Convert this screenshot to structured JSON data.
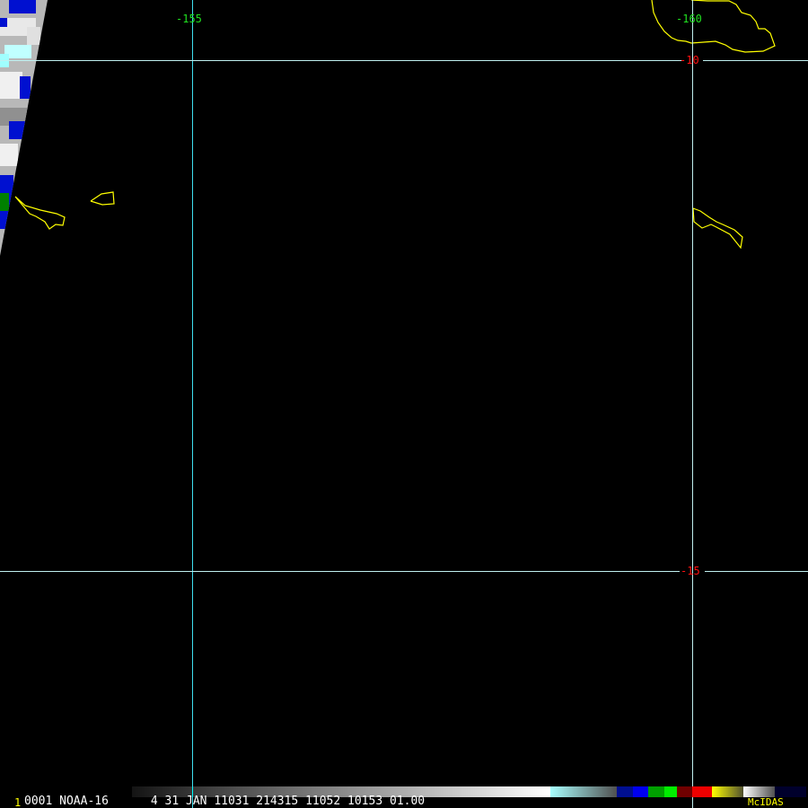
{
  "map": {
    "longitude_labels": [
      "-155",
      "-160"
    ],
    "latitude_labels": [
      "-10",
      "-15"
    ]
  },
  "status_bar": {
    "frame_number": "1",
    "info": "0001 NOAA-16      4 31 JAN 11031 214315 11052 10153 01.00",
    "brand": "McIDAS"
  },
  "colors": {
    "grid": "#40e0f0",
    "coast": "#ffff00",
    "lon_label": "#20e020",
    "lat_label": "#ff1010",
    "brand": "#ffff00"
  }
}
